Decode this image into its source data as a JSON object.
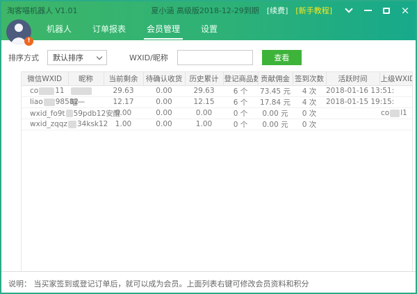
{
  "colors": {
    "header_gradient_start": "#3eb668",
    "header_gradient_end": "#17a98b",
    "frame_border": "#2aab88",
    "button_green": "#3eb33a",
    "tutorial_yellow": "#f6e71f",
    "badge_orange": "#f0661f",
    "avatar_blue": "#4b5c7e"
  },
  "titlebar": {
    "title": "淘客喵机器人 V1.01",
    "account": "夏小涵 高级版2018-12-29到期",
    "renew_label": "[续费]",
    "tutorial_label": "[新手教程]",
    "close_glyph": "×"
  },
  "avatar": {
    "badge": "!"
  },
  "tabs": [
    {
      "label": "机器人",
      "active": false
    },
    {
      "label": "订单报表",
      "active": false
    },
    {
      "label": "会员管理",
      "active": true
    },
    {
      "label": "设置",
      "active": false
    }
  ],
  "filter": {
    "sort_label": "排序方式",
    "sort_value": "默认排序",
    "wxid_label": "WXID/昵称",
    "search_value": "",
    "view_button": "查看"
  },
  "table": {
    "headers": [
      "微信WXID",
      "昵称",
      "当前剩余",
      "待确认收货",
      "历史累计",
      "登记商品数",
      "贡献佣金",
      "签到次数",
      "活跃时间",
      "上级WXID"
    ],
    "rows": [
      [
        {
          "pre": "co",
          "red": 22,
          "post": "11"
        },
        {
          "red": 30
        },
        {
          "pre": "29.63"
        },
        {
          "pre": "0.00"
        },
        {
          "pre": "29.63"
        },
        {
          "pre": "6 个"
        },
        {
          "pre": "73.45 元"
        },
        {
          "pre": "4 次"
        },
        {
          "pre": "2018-01-16 13:51:"
        },
        {}
      ],
      [
        {
          "pre": "liao",
          "red": 16,
          "post": "98582"
        },
        {
          "pre": "喵一"
        },
        {
          "pre": "12.17"
        },
        {
          "pre": "0.00"
        },
        {
          "pre": "12.15"
        },
        {
          "pre": "6 个"
        },
        {
          "pre": "17.84 元"
        },
        {
          "pre": "4 次"
        },
        {
          "pre": "2018-01-15 19:15:"
        },
        {}
      ],
      [
        {
          "pre": "wxid_fo9t",
          "red": 10,
          "post": "59pdb12安醒"
        },
        {},
        {
          "pre": "0.00"
        },
        {
          "pre": "0.00"
        },
        {
          "pre": "0.00"
        },
        {
          "pre": "0 个"
        },
        {
          "pre": "0.00 元"
        },
        {
          "pre": "0 次"
        },
        {},
        {
          "pre": "co",
          "red": 14,
          "post": "l1"
        }
      ],
      [
        {
          "pre": "wxid_zqqz",
          "red": 12,
          "post": "34ksk12"
        },
        {},
        {
          "pre": "1.00"
        },
        {
          "pre": "0.00"
        },
        {
          "pre": "1.00"
        },
        {
          "pre": "0 个"
        },
        {
          "pre": "0.00 元"
        },
        {
          "pre": "0 次"
        },
        {},
        {}
      ]
    ]
  },
  "footer": {
    "note": "说明： 当买家签到或登记订单后，就可以成为会员。上面列表右键可修改会员资料和积分"
  }
}
